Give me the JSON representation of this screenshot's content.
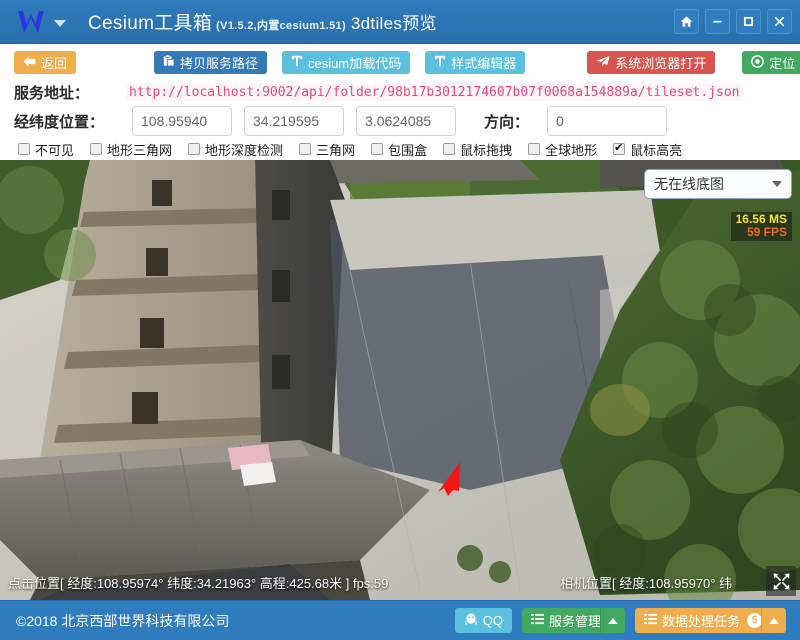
{
  "titlebar": {
    "logo_icon": "w-logo-icon",
    "dropdown_icon": "chevron-down-icon",
    "title": "Cesium工具箱",
    "version": "(V1.5.2,内置cesium1.51)",
    "subtitle": "3dtiles预览",
    "buttons": [
      {
        "name": "home-button",
        "icon": "home-icon"
      },
      {
        "name": "minimize-button",
        "icon": "minimize-icon"
      },
      {
        "name": "maximize-button",
        "icon": "maximize-icon"
      },
      {
        "name": "close-button",
        "icon": "close-icon"
      }
    ]
  },
  "toolbar": {
    "back_label": "返回",
    "back_icon": "arrow-left-icon",
    "copy_path_label": "拷贝服务路径",
    "copy_path_icon": "clipboard-icon",
    "cesium_code_label": "cesium加载代码",
    "cesium_code_icon": "text-format-icon",
    "style_editor_label": "样式编辑器",
    "style_editor_icon": "text-format-icon",
    "open_browser_label": "系统浏览器打开",
    "open_browser_icon": "send-icon",
    "locate_label": "定位",
    "locate_icon": "target-icon"
  },
  "form": {
    "service_url_label": "服务地址：",
    "service_url_value": "http://localhost:9002/api/folder/98b17b3012174607b07f0068a154889a/tileset.json",
    "lonlat_label": "经纬度位置：",
    "longitude_value": "108.95940",
    "latitude_value": "34.219595",
    "height_value": "3.0624085",
    "direction_label": "方向：",
    "direction_value": "0",
    "checkboxes": [
      {
        "label": "不可见",
        "checked": false
      },
      {
        "label": "地形三角网",
        "checked": false
      },
      {
        "label": "地形深度检测",
        "checked": false
      },
      {
        "label": "三角网",
        "checked": false
      },
      {
        "label": "包围盒",
        "checked": false
      },
      {
        "label": "鼠标拖拽",
        "checked": false
      },
      {
        "label": "全球地形",
        "checked": false
      },
      {
        "label": "鼠标高亮",
        "checked": true
      }
    ]
  },
  "viewer": {
    "basemap_selected": "无在线底图",
    "basemap_caret_icon": "chevron-down-icon",
    "perf_ms": "16.56 MS",
    "perf_fps": "59 FPS",
    "perf_ms_color": "#f2e51c",
    "perf_fps_color": "#ef6b22",
    "status_left": "点击位置[ 经度:108.95974° 纬度:34.21963° 高程:425.68米 ] fps:59",
    "status_right": "相机位置[ 经度:108.95970° 纬",
    "fullscreen_icon": "fullscreen-expand-icon",
    "marker_icon": "red-arrow-cursor-icon"
  },
  "footer": {
    "copyright": "©2018 北京西部世界科技有限公司",
    "qq_label": "QQ",
    "qq_icon": "qq-icon",
    "service_label": "服务管理",
    "service_icon": "list-icon",
    "service_caret_icon": "chevron-up-icon",
    "task_label": "数据处理任务",
    "task_icon": "list-icon",
    "task_badge": "5",
    "task_caret_icon": "chevron-up-icon"
  },
  "colors": {
    "brand_blue": "#2f7cbe",
    "warning_orange": "#f0ad4e",
    "primary_blue": "#337ab7",
    "info_cyan": "#5bc0de",
    "danger_red": "#d9534f",
    "success_green": "#41a85f",
    "url_pink": "#e8467c"
  }
}
